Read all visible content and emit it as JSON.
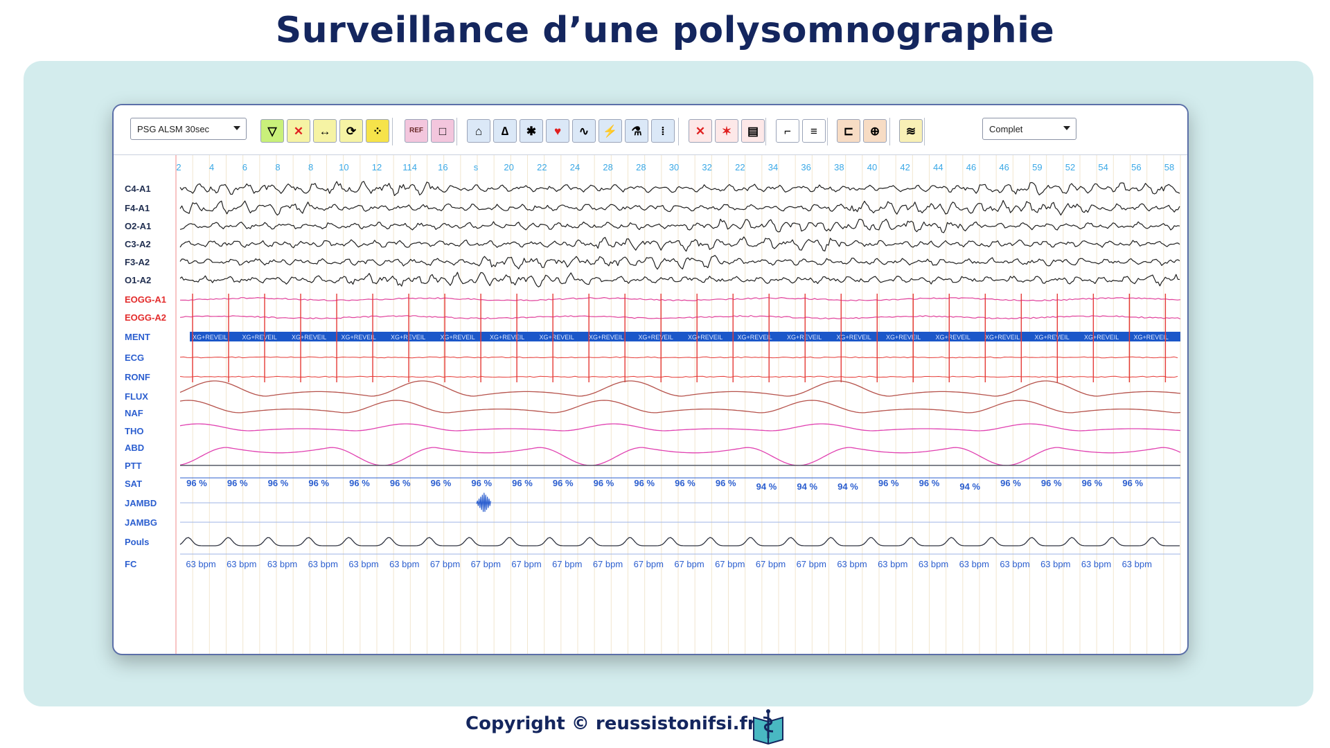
{
  "title": "Surveillance d’une polysomnographie",
  "footer": {
    "copyright": "Copyright © reussistonifsi.fr",
    "logo_icon": "book-caduceus-icon"
  },
  "toolbar": {
    "montage_select": "PSG ALSM 30sec",
    "view_select": "Complet",
    "ref_label": "REF",
    "buttons": [
      {
        "name": "filter-icon",
        "glyph": "▽",
        "bg": "#c9f07a"
      },
      {
        "name": "remove-marker-icon",
        "glyph": "✕",
        "bg": "#f6f3a4"
      },
      {
        "name": "interval-icon",
        "glyph": "↔",
        "bg": "#f6f3a4"
      },
      {
        "name": "refresh-icon",
        "glyph": "⟳",
        "bg": "#f6f3a4"
      },
      {
        "name": "grid-dots-icon",
        "glyph": "⁘",
        "bg": "#f6e34a"
      },
      {
        "name": "ref-icon",
        "glyph": "REF",
        "bg": "#f3c6dd"
      },
      {
        "name": "frame-icon",
        "glyph": "□",
        "bg": "#f3c6dd"
      },
      {
        "name": "lungs-icon",
        "glyph": "⌂",
        "bg": "#dbe8f7"
      },
      {
        "name": "nose-icon",
        "glyph": "∆",
        "bg": "#dbe8f7"
      },
      {
        "name": "body-movement-icon",
        "glyph": "✱",
        "bg": "#dbe8f7"
      },
      {
        "name": "heart-icon",
        "glyph": "♥",
        "bg": "#dbe8f7"
      },
      {
        "name": "wave-icon",
        "glyph": "∿",
        "bg": "#dbe8f7"
      },
      {
        "name": "lightning-icon",
        "glyph": "⚡",
        "bg": "#dbe8f7"
      },
      {
        "name": "microscope-icon",
        "glyph": "⚗",
        "bg": "#dbe8f7"
      },
      {
        "name": "spectrum-icon",
        "glyph": "⁞",
        "bg": "#dbe8f7"
      },
      {
        "name": "delete-event-icon",
        "glyph": "✕",
        "bg": "#fde8e8"
      },
      {
        "name": "artifact-icon",
        "glyph": "✶",
        "bg": "#fde8e8"
      },
      {
        "name": "export-icon",
        "glyph": "▤",
        "bg": "#fde8e8"
      },
      {
        "name": "signal-view-icon",
        "glyph": "⌐",
        "bg": "#ffffff"
      },
      {
        "name": "hypnogram-icon",
        "glyph": "≡",
        "bg": "#ffffff"
      },
      {
        "name": "position-icon",
        "glyph": "⊏",
        "bg": "#f7dcc4"
      },
      {
        "name": "target-icon",
        "glyph": "⊕",
        "bg": "#f7dcc4"
      },
      {
        "name": "overview-icon",
        "glyph": "≋",
        "bg": "#f8f0b6"
      }
    ]
  },
  "time_axis": [
    "2",
    "4",
    "6",
    "8",
    "8",
    "10",
    "12",
    "114",
    "16",
    "s",
    "20",
    "22",
    "24",
    "28",
    "28",
    "30",
    "32",
    "22",
    "34",
    "36",
    "38",
    "40",
    "42",
    "44",
    "46",
    "46",
    "59",
    "52",
    "54",
    "56",
    "58"
  ],
  "channels": [
    {
      "label": "C4-A1",
      "color": "#1f1f1f",
      "label_color": "#1f2d4f"
    },
    {
      "label": "F4-A1",
      "color": "#1f1f1f",
      "label_color": "#1f2d4f"
    },
    {
      "label": "O2-A1",
      "color": "#1f1f1f",
      "label_color": "#1f2d4f"
    },
    {
      "label": "C3-A2",
      "color": "#1f1f1f",
      "label_color": "#1f2d4f"
    },
    {
      "label": "F3-A2",
      "color": "#1f1f1f",
      "label_color": "#1f2d4f"
    },
    {
      "label": "O1-A2",
      "color": "#1f1f1f",
      "label_color": "#1f2d4f"
    },
    {
      "label": "EOGG-A1",
      "color": "#e0409a",
      "label_color": "#e32b2b"
    },
    {
      "label": "EOGG-A2",
      "color": "#e0409a",
      "label_color": "#e32b2b"
    },
    {
      "label": "MENT",
      "color": "#1b57c9",
      "label_color": "#2b5ecf"
    },
    {
      "label": "ECG",
      "color": "#e53935",
      "label_color": "#2b5ecf"
    },
    {
      "label": "RONF",
      "color": "#e53935",
      "label_color": "#2b5ecf"
    },
    {
      "label": "FLUX",
      "color": "#b5514a",
      "label_color": "#2b5ecf"
    },
    {
      "label": "NAF",
      "color": "#b5514a",
      "label_color": "#2b5ecf"
    },
    {
      "label": "THO",
      "color": "#e040b0",
      "label_color": "#2b5ecf"
    },
    {
      "label": "ABD",
      "color": "#e040b0",
      "label_color": "#2b5ecf"
    },
    {
      "label": "PTT",
      "color": "#555a66",
      "label_color": "#2b5ecf"
    },
    {
      "label": "SAT",
      "color": "#2b5ecf",
      "label_color": "#2b5ecf"
    },
    {
      "label": "JAMBD",
      "color": "#2b5ecf",
      "label_color": "#2b5ecf"
    },
    {
      "label": "JAMBG",
      "color": "#2b5ecf",
      "label_color": "#2b5ecf"
    },
    {
      "label": "Pouls",
      "color": "#2f3340",
      "label_color": "#2b5ecf"
    },
    {
      "label": "FC",
      "color": "#2b5ecf",
      "label_color": "#2b5ecf"
    }
  ],
  "sat_values": [
    "96 %",
    "96 %",
    "96 %",
    "96 %",
    "96 %",
    "96 %",
    "96 %",
    "96 %",
    "96 %",
    "96 %",
    "96 %",
    "96 %",
    "96 %",
    "96 %",
    "94 %",
    "94 %",
    "94 %",
    "96 %",
    "96 %",
    "94 %",
    "96 %",
    "96 %",
    "96 %",
    "96 %"
  ],
  "fc_values": [
    "63 bpm",
    "63 bpm",
    "63 bpm",
    "63 bpm",
    "63 bpm",
    "63 bpm",
    "67 bpm",
    "67 bpm",
    "67 bpm",
    "67 bpm",
    "67 bpm",
    "67 bpm",
    "67 bpm",
    "67 bpm",
    "67 bpm",
    "67 bpm",
    "63 bpm",
    "63 bpm",
    "63 bpm",
    "63 bpm",
    "63 bpm",
    "63 bpm",
    "63 bpm",
    "63 bpm"
  ],
  "ment_label": "XG+REVEIL",
  "colors": {
    "accent": "#14265e",
    "backdrop": "#d3eced",
    "ment_band": "#1b57c9",
    "marker_red": "#e53935"
  }
}
